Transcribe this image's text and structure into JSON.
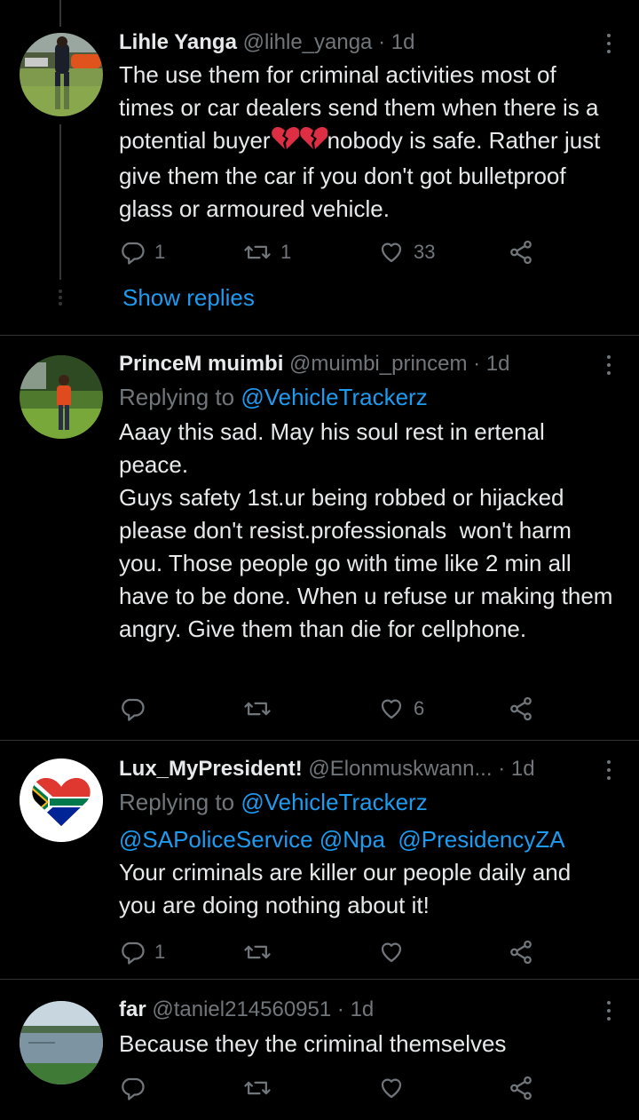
{
  "tweets": [
    {
      "name": "Lihle Yanga",
      "handle": "@lihle_yanga",
      "time": "· 1d",
      "reply_prefix": "",
      "reply_target": "",
      "text_before_emoji": "The use them for criminal activities most of times or car dealers send them when there is a potential buyer",
      "emoji": "broken-heart",
      "text_after_emoji": "nobody is safe. Rather just give them the car if you don't got bulletproof glass or armoured vehicle.",
      "counts": {
        "reply": "1",
        "retweet": "1",
        "like": "33"
      }
    },
    {
      "name": "PrinceM muimbi",
      "handle": "@muimbi_princem",
      "time": "· 1d",
      "reply_prefix": "Replying to ",
      "reply_target": "@VehicleTrackerz",
      "text": "Aaay this sad. May his soul rest in ertenal peace.\nGuys safety 1st.ur being robbed or hijacked please don't resist.professionals  won't harm you. Those people go with time like 2 min all have to be done. When u refuse ur making them angry. Give them than die for cellphone.",
      "counts": {
        "reply": "",
        "retweet": "",
        "like": "6"
      }
    },
    {
      "name": "Lux_MyPresident!",
      "handle": "@Elonmuskwann...",
      "time": "· 1d",
      "reply_prefix": "Replying to ",
      "reply_target": "@VehicleTrackerz",
      "mentions": [
        "@SAPoliceService",
        "@Npa",
        "@PresidencyZA"
      ],
      "text": "Your criminals are killer our people daily and you are doing nothing about it!",
      "counts": {
        "reply": "1",
        "retweet": "",
        "like": ""
      }
    },
    {
      "name": "far",
      "handle": "@taniel214560951",
      "time": "· 1d",
      "text": "Because they the criminal themselves",
      "counts": {
        "reply": "",
        "retweet": "",
        "like": ""
      }
    }
  ],
  "show_replies_label": "Show replies",
  "colors": {
    "background": "#000000",
    "text": "#e7e9ea",
    "muted": "#71767b",
    "link": "#1d9bf0",
    "divider": "#2f3336"
  },
  "icons": [
    "reply-icon",
    "retweet-icon",
    "like-icon",
    "share-icon",
    "more-icon",
    "broken-heart-emoji"
  ]
}
